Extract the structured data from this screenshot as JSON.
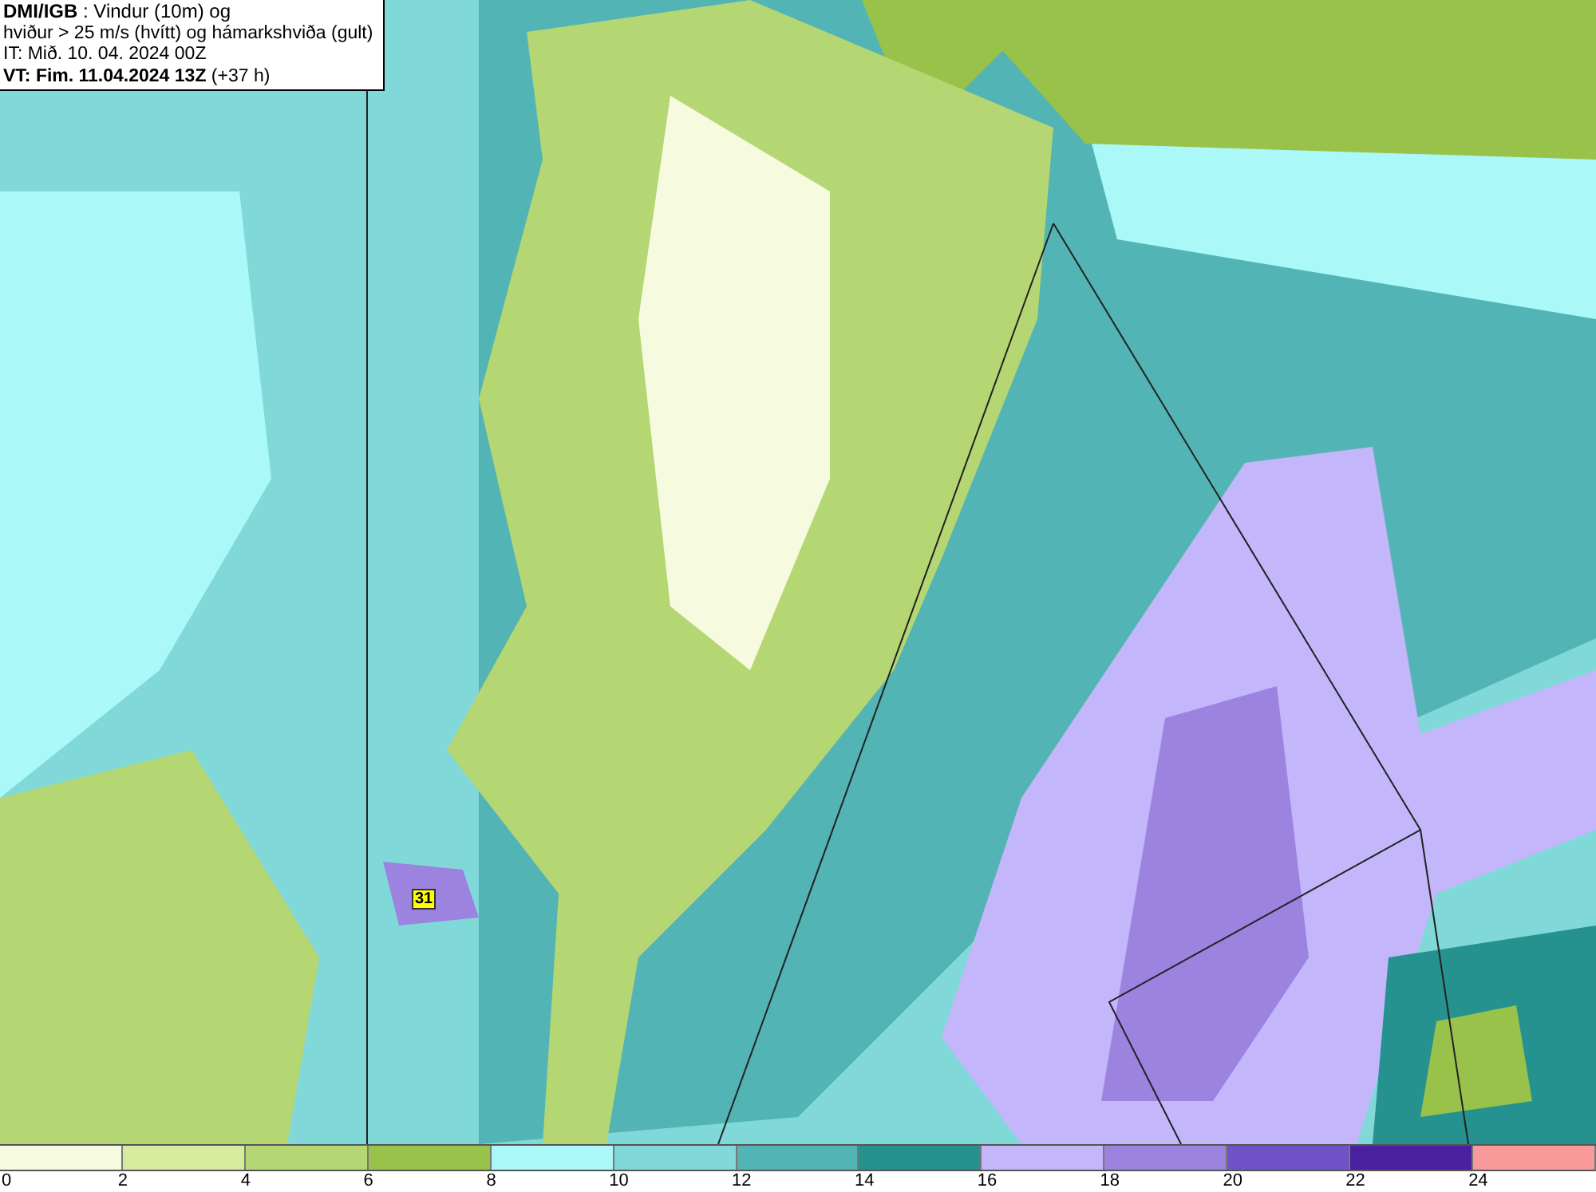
{
  "title_box": {
    "lines": [
      "**DMI/IGB** : Vindur (10m) og",
      "hviður > 25 m/s (hvítt) og hámarkshviða (gult)",
      "IT: Mið. 10. 04. 2024 00Z",
      "**VT: Fim. 11.04.2024 13Z** (+37 h)"
    ]
  },
  "map": {
    "max_gust_label": "31"
  },
  "legend": [
    {
      "label": "0",
      "color": "#f6fbdf"
    },
    {
      "label": "2",
      "color": "#d6ec9c"
    },
    {
      "label": "4",
      "color": "#b4d673"
    },
    {
      "label": "6",
      "color": "#98c24a"
    },
    {
      "label": "8",
      "color": "#aaf8f8"
    },
    {
      "label": "10",
      "color": "#80d8d8"
    },
    {
      "label": "12",
      "color": "#52b4b4"
    },
    {
      "label": "14",
      "color": "#25928f"
    },
    {
      "label": "16",
      "color": "#c4b6fb"
    },
    {
      "label": "18",
      "color": "#9c83e0"
    },
    {
      "label": "20",
      "color": "#7052c8"
    },
    {
      "label": "22",
      "color": "#4a20a0"
    },
    {
      "label": "24",
      "color": "#f89a9a"
    }
  ]
}
